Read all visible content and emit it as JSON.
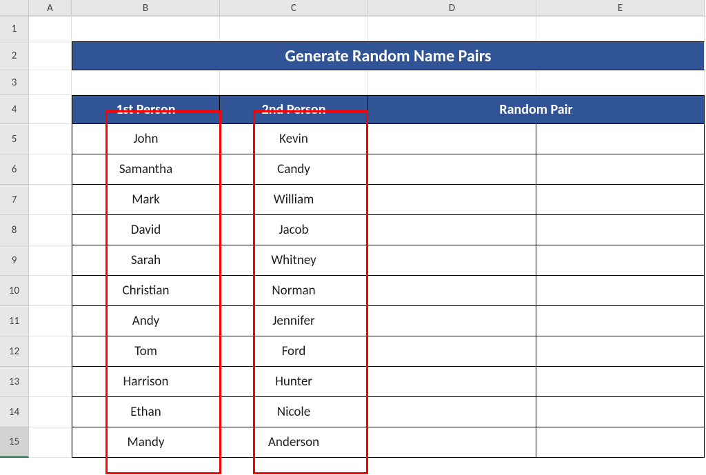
{
  "columns": [
    "A",
    "B",
    "C",
    "D",
    "E"
  ],
  "rows": [
    "1",
    "2",
    "3",
    "4",
    "5",
    "6",
    "7",
    "8",
    "9",
    "10",
    "11",
    "12",
    "13",
    "14",
    "15"
  ],
  "title": "Generate Random Name Pairs",
  "headers": {
    "b": "1st Person",
    "c": "2nd Person",
    "de": "Random Pair"
  },
  "chart_data": {
    "type": "table",
    "columns": [
      "1st Person",
      "2nd Person"
    ],
    "rows": [
      [
        "John",
        "Kevin"
      ],
      [
        "Samantha",
        "Candy"
      ],
      [
        "Mark",
        "William"
      ],
      [
        "David",
        "Jacob"
      ],
      [
        "Sarah",
        "Whitney"
      ],
      [
        "Christian",
        "Norman"
      ],
      [
        "Andy",
        "Jennifer"
      ],
      [
        "Tom",
        "Ford"
      ],
      [
        "Harrison",
        "Hunter"
      ],
      [
        "Ethan",
        "Nicole"
      ],
      [
        "Mandy",
        "Anderson"
      ]
    ]
  },
  "selected_row": "15"
}
